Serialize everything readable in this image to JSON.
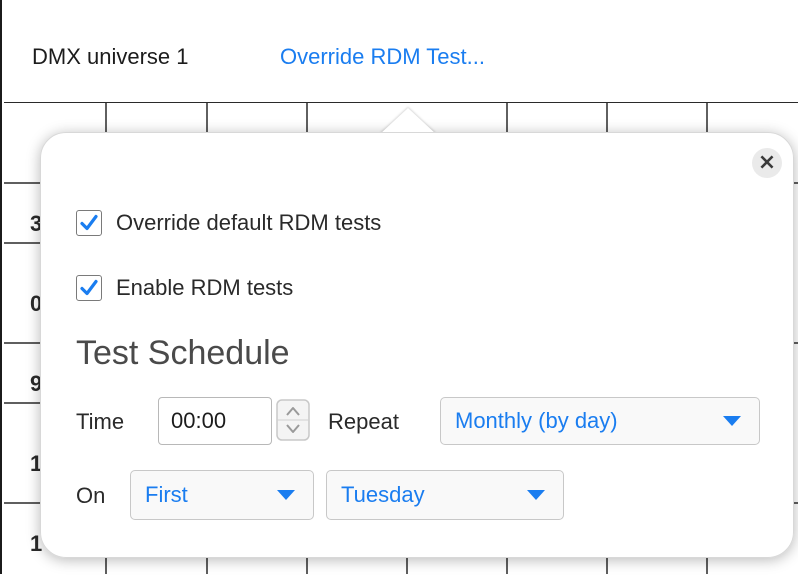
{
  "header": {
    "title": "DMX universe 1",
    "link": "Override RDM Test..."
  },
  "popover": {
    "close_icon": "close-icon",
    "override_default": {
      "label": "Override default RDM tests",
      "checked": true
    },
    "enable_tests": {
      "label": "Enable RDM tests",
      "checked": true
    },
    "section_title": "Test Schedule",
    "time": {
      "label": "Time",
      "value": "00:00"
    },
    "repeat": {
      "label": "Repeat",
      "value": "Monthly (by day)"
    },
    "on": {
      "label": "On",
      "ordinal": "First",
      "weekday": "Tuesday"
    }
  },
  "background_grid": {
    "row_fragments": [
      "3",
      "0",
      "9",
      "1",
      "1"
    ]
  },
  "colors": {
    "accent": "#1a7df0",
    "grid_line": "#2a2a2a",
    "text": "#2a2a2a"
  }
}
